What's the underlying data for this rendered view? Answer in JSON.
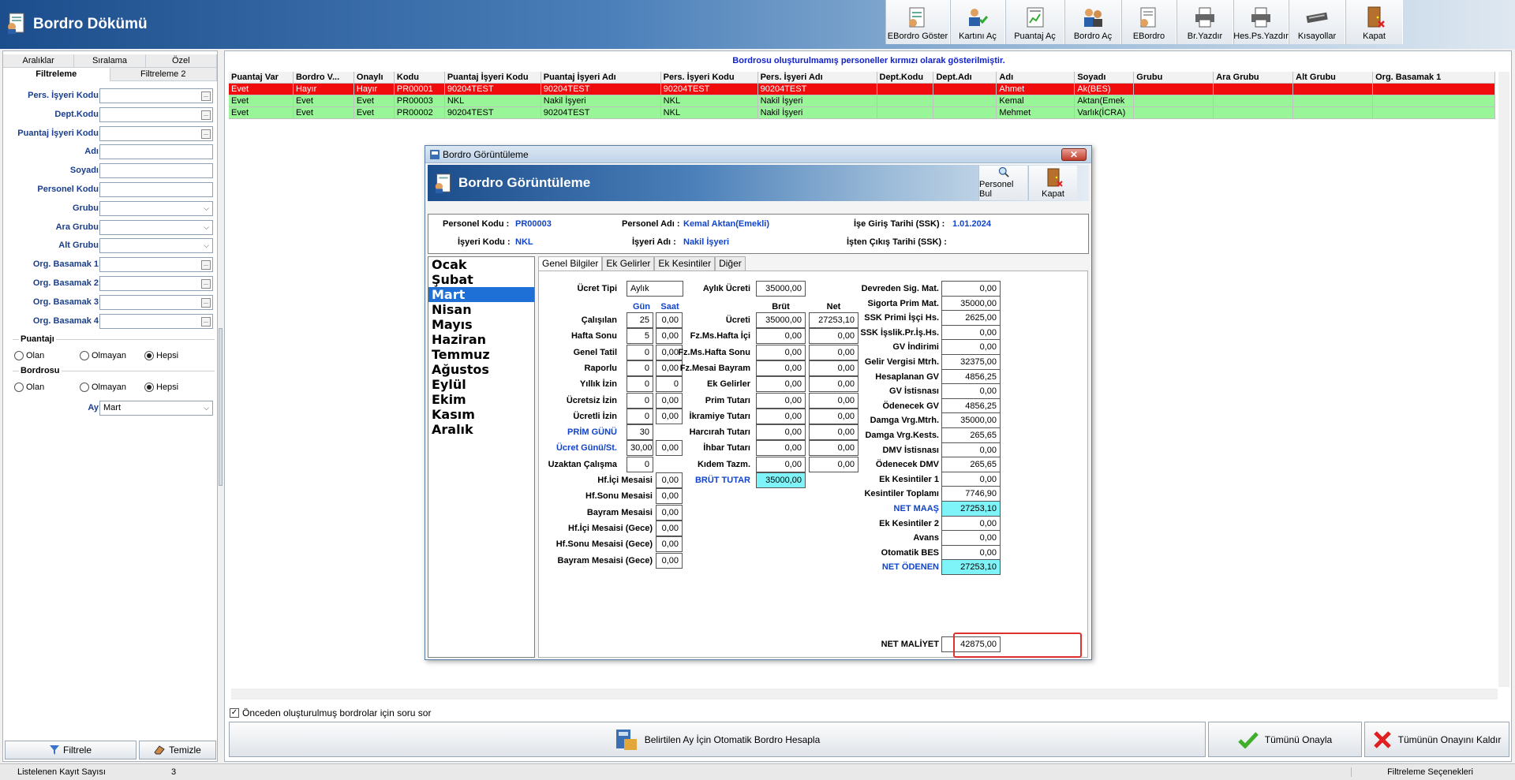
{
  "app": {
    "title": "Bordro Dökümü"
  },
  "toolbar": [
    {
      "label": "EBordro Göster",
      "icon": "report-icon"
    },
    {
      "label": "Kartını Aç",
      "icon": "user-card-icon"
    },
    {
      "label": "Puantaj Aç",
      "icon": "timesheet-icon"
    },
    {
      "label": "Bordro Aç",
      "icon": "payroll-icon"
    },
    {
      "label": "EBordro",
      "icon": "ebordro-icon"
    },
    {
      "label": "Br.Yazdır",
      "icon": "printer-icon"
    },
    {
      "label": "Hes.Ps.Yazdır",
      "icon": "printer-icon"
    },
    {
      "label": "Kısayollar",
      "icon": "keyboard-icon"
    },
    {
      "label": "Kapat",
      "icon": "door-icon"
    }
  ],
  "left": {
    "tabs_top": [
      "Aralıklar",
      "Sıralama",
      "Özel"
    ],
    "tabs_bottom": [
      "Filtreleme",
      "Filtreleme 2"
    ],
    "fields": [
      {
        "label": "Pers. İşyeri Kodu",
        "value": "",
        "type": "ellipsis"
      },
      {
        "label": "Dept.Kodu",
        "value": "",
        "type": "ellipsis"
      },
      {
        "label": "Puantaj İşyeri Kodu",
        "value": "",
        "type": "ellipsis"
      },
      {
        "label": "Adı",
        "value": "",
        "type": "text"
      },
      {
        "label": "Soyadı",
        "value": "",
        "type": "text"
      },
      {
        "label": "Personel Kodu",
        "value": "",
        "type": "text"
      },
      {
        "label": "Grubu",
        "value": "",
        "type": "combo"
      },
      {
        "label": "Ara Grubu",
        "value": "",
        "type": "combo"
      },
      {
        "label": "Alt Grubu",
        "value": "",
        "type": "combo"
      },
      {
        "label": "Org. Basamak 1",
        "value": "",
        "type": "ellipsis"
      },
      {
        "label": "Org. Basamak 2",
        "value": "",
        "type": "ellipsis"
      },
      {
        "label": "Org. Basamak 3",
        "value": "",
        "type": "ellipsis"
      },
      {
        "label": "Org. Basamak 4",
        "value": "",
        "type": "ellipsis"
      }
    ],
    "puantaj": {
      "title": "Puantajı",
      "options": [
        "Olan",
        "Olmayan",
        "Hepsi"
      ],
      "selected": 2
    },
    "bordro": {
      "title": "Bordrosu",
      "options": [
        "Olan",
        "Olmayan",
        "Hepsi"
      ],
      "selected": 2
    },
    "ay": {
      "label": "Ay",
      "value": "Mart"
    },
    "filter_button": "Filtrele",
    "clear_button": "Temizle"
  },
  "main": {
    "notice": "Bordrosu oluşturulmamış personeller kırmızı olarak gösterilmiştir.",
    "columns": [
      "Puantaj Var",
      "Bordro V...",
      "Onaylı",
      "Kodu",
      "Puantaj İşyeri Kodu",
      "Puantaj İşyeri Adı",
      "Pers. İşyeri Kodu",
      "Pers. İşyeri Adı",
      "Dept.Kodu",
      "Dept.Adı",
      "Adı",
      "Soyadı",
      "Grubu",
      "Ara Grubu",
      "Alt Grubu",
      "Org. Basamak 1"
    ],
    "rows": [
      {
        "status": "red",
        "cells": [
          "Evet",
          "Hayır",
          "Hayır",
          "PR00001",
          "90204TEST",
          "90204TEST",
          "90204TEST",
          "90204TEST",
          "",
          "",
          "Ahmet",
          "Ak(BES)",
          "",
          "",
          "",
          ""
        ]
      },
      {
        "status": "green",
        "cells": [
          "Evet",
          "Evet",
          "Evet",
          "PR00003",
          "NKL",
          "Nakil İşyeri",
          "NKL",
          "Nakil İşyeri",
          "",
          "",
          "Kemal",
          "Aktan(Emek",
          "",
          "",
          "",
          ""
        ]
      },
      {
        "status": "green",
        "cells": [
          "Evet",
          "Evet",
          "Evet",
          "PR00002",
          "90204TEST",
          "90204TEST",
          "NKL",
          "Nakil İşyeri",
          "",
          "",
          "Mehmet",
          "Varlık(İCRA)",
          "",
          "",
          "",
          ""
        ]
      }
    ],
    "ask_checkbox": "Önceden oluşturulmuş bordrolar için soru sor",
    "calc_button": "Belirtilen Ay İçin Otomatik Bordro Hesapla",
    "approve_all": "Tümünü Onayla",
    "unapprove_all": "Tümünün Onayını Kaldır"
  },
  "status": {
    "count_label": "Listelenen Kayıt Sayısı",
    "count": "3",
    "filter_options": "Filtreleme Seçenekleri"
  },
  "dialog": {
    "window_title": "Bordro Görüntüleme",
    "header_title": "Bordro Görüntüleme",
    "btn_find": "Personel Bul",
    "btn_close": "Kapat",
    "info": {
      "personel_kodu_label": "Personel Kodu :",
      "personel_kodu": "PR00003",
      "personel_adi_label": "Personel Adı :",
      "personel_adi": "Kemal Aktan(Emekli)",
      "ise_giris_label": "İşe Giriş Tarihi (SSK) :",
      "ise_giris": "1.01.2024",
      "isyeri_kodu_label": "İşyeri Kodu :",
      "isyeri_kodu": "NKL",
      "isyeri_adi_label": "İşyeri Adı :",
      "isyeri_adi": "Nakil İşyeri",
      "isten_cikis_label": "İşten Çıkış Tarihi (SSK) :",
      "isten_cikis": ""
    },
    "months": [
      "Ocak",
      "Şubat",
      "Mart",
      "Nisan",
      "Mayıs",
      "Haziran",
      "Temmuz",
      "Ağustos",
      "Eylül",
      "Ekim",
      "Kasım",
      "Aralık"
    ],
    "selected_month": 2,
    "tabs": [
      "Genel Bilgiler",
      "Ek Gelirler",
      "Ek Kesintiler",
      "Diğer"
    ],
    "ucret_tipi_label": "Ücret Tipi",
    "ucret_tipi": "Aylık",
    "aylik_ucret_label": "Aylık Ücreti",
    "aylik_ucret": "35000,00",
    "gun_header": "Gün",
    "saat_header": "Saat",
    "brut_header": "Brüt",
    "net_header": "Net",
    "days": [
      {
        "label": "Çalışılan",
        "gun": "25",
        "saat": "0,00"
      },
      {
        "label": "Hafta Sonu",
        "gun": "5",
        "saat": "0,00"
      },
      {
        "label": "Genel Tatil",
        "gun": "0",
        "saat": "0,00"
      },
      {
        "label": "Raporlu",
        "gun": "0",
        "saat": "0,00"
      },
      {
        "label": "Yıllık İzin",
        "gun": "0",
        "saat": "0"
      },
      {
        "label": "Ücretsiz İzin",
        "gun": "0",
        "saat": "0,00"
      },
      {
        "label": "Ücretli İzin",
        "gun": "0",
        "saat": "0,00"
      }
    ],
    "prim_gunu_label": "PRİM GÜNÜ",
    "prim_gunu": "30",
    "ucret_gunu_label": "Ücret Günü/St.",
    "ucret_gunu": "30,00",
    "ucret_gunu_saat": "0,00",
    "uzaktan_label": "Uzaktan Çalışma",
    "uzaktan": "0",
    "mesai": [
      {
        "label": "Hf.İçi Mesaisi",
        "value": "0,00"
      },
      {
        "label": "Hf.Sonu Mesaisi",
        "value": "0,00"
      },
      {
        "label": "Bayram Mesaisi",
        "value": "0,00"
      },
      {
        "label": "Hf.İçi Mesaisi (Gece)",
        "value": "0,00"
      },
      {
        "label": "Hf.Sonu Mesaisi (Gece)",
        "value": "0,00"
      },
      {
        "label": "Bayram Mesaisi (Gece)",
        "value": "0,00"
      }
    ],
    "earnings": [
      {
        "label": "Ücreti",
        "brut": "35000,00",
        "net": "27253,10"
      },
      {
        "label": "Fz.Ms.Hafta İçi",
        "brut": "0,00",
        "net": "0,00"
      },
      {
        "label": "Fz.Ms.Hafta Sonu",
        "brut": "0,00",
        "net": "0,00"
      },
      {
        "label": "Fz.Mesai Bayram",
        "brut": "0,00",
        "net": "0,00"
      },
      {
        "label": "Ek Gelirler",
        "brut": "0,00",
        "net": "0,00"
      },
      {
        "label": "Prim Tutarı",
        "brut": "0,00",
        "net": "0,00"
      },
      {
        "label": "İkramiye Tutarı",
        "brut": "0,00",
        "net": "0,00"
      },
      {
        "label": "Harcırah Tutarı",
        "brut": "0,00",
        "net": "0,00"
      },
      {
        "label": "İhbar Tutarı",
        "brut": "0,00",
        "net": "0,00"
      },
      {
        "label": "Kıdem Tazm.",
        "brut": "0,00",
        "net": "0,00"
      }
    ],
    "brut_tutar_label": "BRÜT TUTAR",
    "brut_tutar": "35000,00",
    "summary": [
      {
        "label": "Devreden Sig. Mat.",
        "value": "0,00"
      },
      {
        "label": "Sigorta Prim Mat.",
        "value": "35000,00"
      },
      {
        "label": "SSK Primi İşçi Hs.",
        "value": "2625,00"
      },
      {
        "label": "SSK İşslik.Pr.İş.Hs.",
        "value": "0,00"
      },
      {
        "label": "GV İndirimi",
        "value": "0,00"
      },
      {
        "label": "Gelir Vergisi Mtrh.",
        "value": "32375,00"
      },
      {
        "label": "Hesaplanan GV",
        "value": "4856,25"
      },
      {
        "label": "GV İstisnası",
        "value": "0,00"
      },
      {
        "label": "Ödenecek GV",
        "value": "4856,25"
      },
      {
        "label": "Damga Vrg.Mtrh.",
        "value": "35000,00"
      },
      {
        "label": "Damga Vrg.Kests.",
        "value": "265,65"
      },
      {
        "label": "DMV İstisnası",
        "value": "0,00"
      },
      {
        "label": "Ödenecek DMV",
        "value": "265,65"
      },
      {
        "label": "Ek Kesintiler 1",
        "value": "0,00"
      },
      {
        "label": "Kesintiler Toplamı",
        "value": "7746,90"
      },
      {
        "label": "NET MAAŞ",
        "value": "27253,10",
        "highlight": true
      },
      {
        "label": "Ek Kesintiler 2",
        "value": "0,00"
      },
      {
        "label": "Avans",
        "value": "0,00"
      },
      {
        "label": "Otomatik BES",
        "value": "0,00"
      },
      {
        "label": "NET ÖDENEN",
        "value": "27253,10",
        "highlight": true
      }
    ],
    "net_maliyet_label": "NET MALİYET",
    "net_maliyet": "42875,00"
  }
}
